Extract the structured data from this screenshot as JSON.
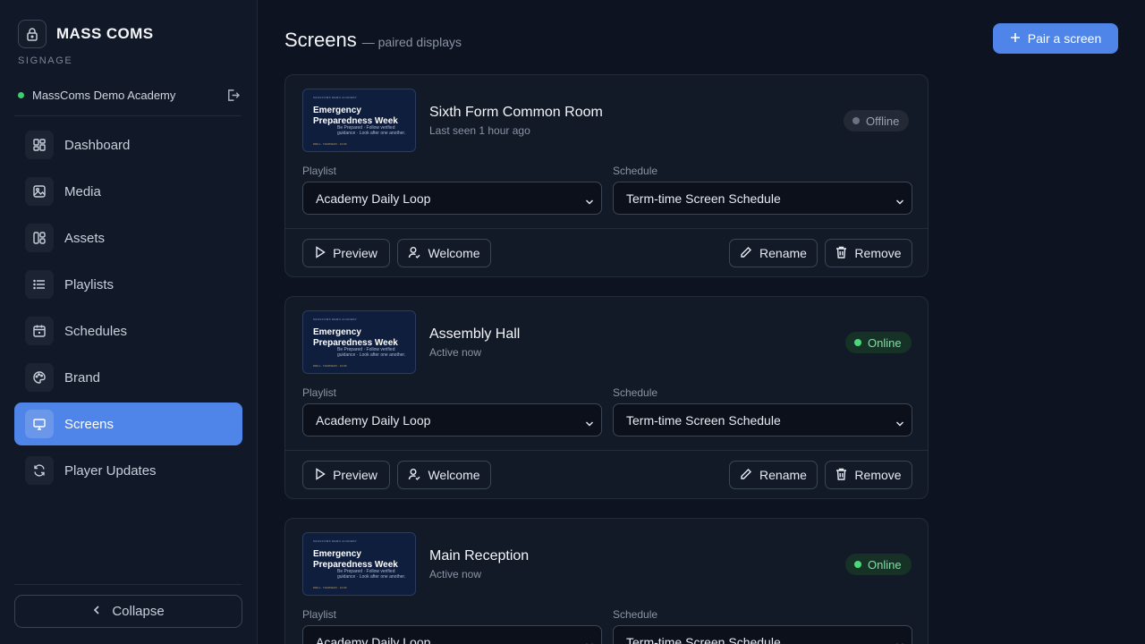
{
  "app": {
    "brand_name": "MASS COMS",
    "brand_sub": "SIGNAGE",
    "org_name": "MassComs Demo Academy"
  },
  "sidebar": {
    "items": [
      {
        "label": "Dashboard",
        "icon": "dashboard-icon"
      },
      {
        "label": "Media",
        "icon": "image-icon"
      },
      {
        "label": "Assets",
        "icon": "assets-icon"
      },
      {
        "label": "Playlists",
        "icon": "list-icon"
      },
      {
        "label": "Schedules",
        "icon": "calendar-icon"
      },
      {
        "label": "Brand",
        "icon": "palette-icon"
      },
      {
        "label": "Screens",
        "icon": "monitor-icon",
        "active": true
      },
      {
        "label": "Player Updates",
        "icon": "refresh-icon"
      }
    ],
    "collapse_label": "Collapse"
  },
  "header": {
    "title": "Screens",
    "subtitle": "— paired displays",
    "pair_button": "Pair a screen"
  },
  "labels": {
    "playlist": "Playlist",
    "schedule": "Schedule",
    "preview": "Preview",
    "welcome": "Welcome",
    "rename": "Rename",
    "remove": "Remove"
  },
  "thumbnail": {
    "org": "MASSCOMS DEMO ACADEMY",
    "headline": "Emergency Preparedness Week",
    "body": "Be Prepared · Follow verified guidance · Look after one another.",
    "footer": "DRILL · THURSDAY · 10:30"
  },
  "screens": [
    {
      "name": "Sixth Form Common Room",
      "seen": "Last seen 1 hour ago",
      "status": "Offline",
      "playlist": "Academy Daily Loop",
      "schedule": "Term-time Screen Schedule"
    },
    {
      "name": "Assembly Hall",
      "seen": "Active now",
      "status": "Online",
      "playlist": "Academy Daily Loop",
      "schedule": "Term-time Screen Schedule"
    },
    {
      "name": "Main Reception",
      "seen": "Active now",
      "status": "Online",
      "playlist": "Academy Daily Loop",
      "schedule": "Term-time Screen Schedule"
    }
  ],
  "colors": {
    "accent": "#4f84e8",
    "online": "#4cd77a",
    "offline": "#6a7382",
    "background": "#0d1320"
  }
}
